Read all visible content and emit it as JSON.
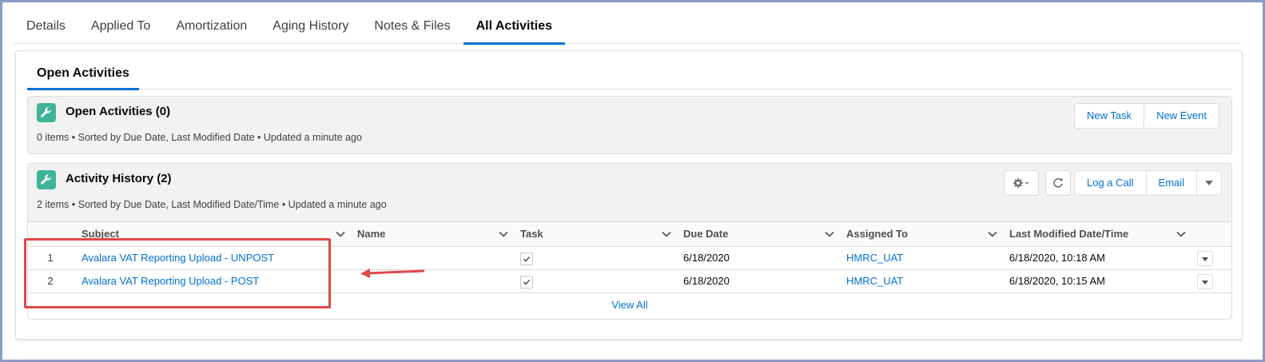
{
  "top_tabs": [
    {
      "label": "Details",
      "active": false
    },
    {
      "label": "Applied To",
      "active": false
    },
    {
      "label": "Amortization",
      "active": false
    },
    {
      "label": "Aging History",
      "active": false
    },
    {
      "label": "Notes & Files",
      "active": false
    },
    {
      "label": "All Activities",
      "active": true
    }
  ],
  "sub_tab": {
    "label": "Open Activities"
  },
  "open_activities": {
    "title": "Open Activities (0)",
    "meta": "0 items • Sorted by Due Date, Last Modified Date • Updated a minute ago",
    "icon": "wrench-icon",
    "buttons": {
      "new_task": "New Task",
      "new_event": "New Event"
    }
  },
  "activity_history": {
    "title": "Activity History (2)",
    "meta": "2 items • Sorted by Due Date, Last Modified Date/Time • Updated a minute ago",
    "icon": "wrench-icon",
    "buttons": {
      "log_call": "Log a Call",
      "email": "Email"
    },
    "columns": {
      "subject": "Subject",
      "name": "Name",
      "task": "Task",
      "due_date": "Due Date",
      "assigned_to": "Assigned To",
      "last_modified": "Last Modified Date/Time"
    },
    "rows": [
      {
        "num": "1",
        "subject": "Avalara VAT Reporting Upload - UNPOST",
        "name": "",
        "task": true,
        "due_date": "6/18/2020",
        "assigned_to": "HMRC_UAT",
        "last_modified": "6/18/2020, 10:18 AM"
      },
      {
        "num": "2",
        "subject": "Avalara VAT Reporting Upload - POST",
        "name": "",
        "task": true,
        "due_date": "6/18/2020",
        "assigned_to": "HMRC_UAT",
        "last_modified": "6/18/2020, 10:15 AM"
      }
    ],
    "view_all": "View All"
  },
  "colors": {
    "accent": "#0070d2",
    "icon_bg": "#3fb498",
    "annotation": "#e04848",
    "frame": "#8c9bc6"
  }
}
